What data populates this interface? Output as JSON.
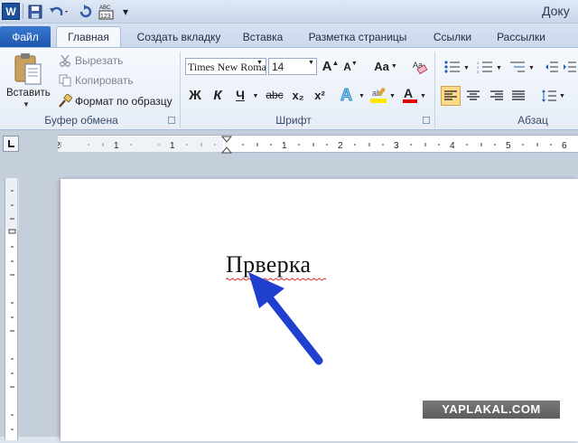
{
  "titlebar": {
    "logo": "W",
    "customize": "▾",
    "title_fragment": "Доку",
    "icons": [
      "word-logo-icon",
      "save-icon",
      "undo-icon",
      "redo-icon",
      "spelling-abc-icon"
    ]
  },
  "tabs": {
    "file": "Файл",
    "home": "Главная",
    "add_tab": "Создать вкладку",
    "insert": "Вставка",
    "page_layout": "Разметка страницы",
    "references": "Ссылки",
    "mailings": "Рассылки"
  },
  "clipboard": {
    "paste": "Вставить",
    "cut": "Вырезать",
    "copy": "Копировать",
    "format_painter": "Формат по образцу",
    "group_label": "Буфер обмена"
  },
  "font": {
    "name": "Times New Roman",
    "size": "14",
    "group_label": "Шрифт",
    "bold": "Ж",
    "italic": "К",
    "underline": "Ч",
    "strike": "abc",
    "subscript": "x₂",
    "superscript": "x²",
    "grow": "A",
    "shrink": "A",
    "case": "Aa"
  },
  "paragraph": {
    "group_label": "Абзац"
  },
  "ruler": {
    "numbers": [
      "2",
      "1",
      "1",
      "1",
      "2",
      "3",
      "4",
      "5",
      "6"
    ]
  },
  "document": {
    "text": "Прверка"
  },
  "watermark": {
    "text": "YAPLAKAL.COM"
  },
  "colors": {
    "accent": "#1d57ad",
    "highlight": "#ffe800",
    "font_color": "#e00000",
    "arrow": "#1f3fcf",
    "squiggle": "#e02020"
  }
}
